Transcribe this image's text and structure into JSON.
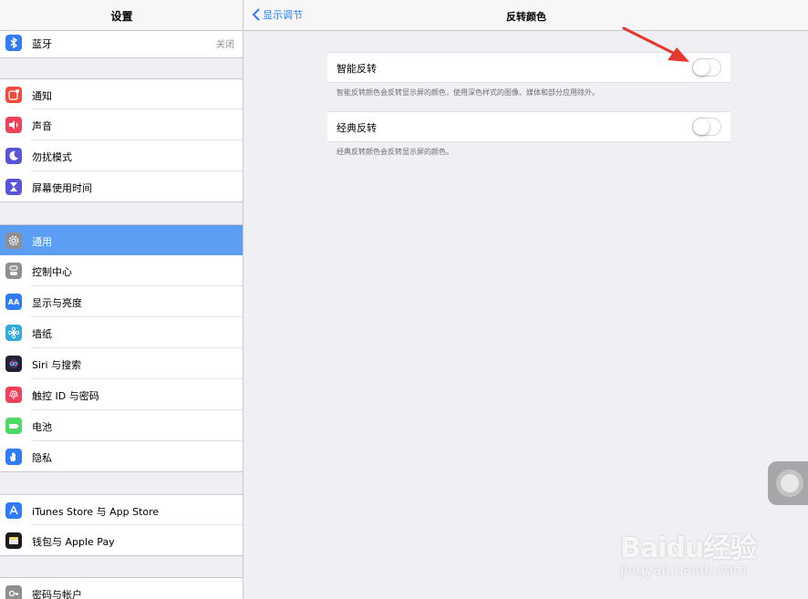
{
  "sidebar": {
    "title": "设置",
    "items": [
      {
        "label": "蓝牙",
        "value": "关闭",
        "icon": "bluetooth-icon",
        "color": "#2f7cf6"
      },
      {
        "label": "通知",
        "icon": "notifications-icon",
        "color": "#f24a3c"
      },
      {
        "label": "声音",
        "icon": "sound-icon",
        "color": "#f0415b"
      },
      {
        "label": "勿扰模式",
        "icon": "moon-icon",
        "color": "#5a55d6"
      },
      {
        "label": "屏幕使用时间",
        "icon": "hourglass-icon",
        "color": "#5a55d6"
      },
      {
        "label": "通用",
        "icon": "gear-icon",
        "color": "#8e8e93"
      },
      {
        "label": "控制中心",
        "icon": "toggles-icon",
        "color": "#8e8e93"
      },
      {
        "label": "显示与亮度",
        "icon": "display-icon",
        "color": "#2f7cf6"
      },
      {
        "label": "墙纸",
        "icon": "wallpaper-icon",
        "color": "#35aadc"
      },
      {
        "label": "Siri 与搜索",
        "icon": "siri-icon",
        "color": "#222233"
      },
      {
        "label": "触控 ID 与密码",
        "icon": "fingerprint-icon",
        "color": "#f0415b"
      },
      {
        "label": "电池",
        "icon": "battery-icon",
        "color": "#4cd964"
      },
      {
        "label": "隐私",
        "icon": "hand-icon",
        "color": "#2f7cf6"
      },
      {
        "label": "iTunes Store 与 App Store",
        "icon": "app-store-icon",
        "color": "#2f7cf6"
      },
      {
        "label": "钱包与 Apple Pay",
        "icon": "wallet-icon",
        "color": "#1c1c1e"
      },
      {
        "label": "密码与帐户",
        "icon": "key-icon",
        "color": "#8e8e93"
      }
    ]
  },
  "nav": {
    "back_label": "显示调节",
    "title": "反转颜色"
  },
  "settings": {
    "smart_invert": {
      "label": "智能反转",
      "footer": "智能反转颜色会反转显示屏的颜色，使用深色样式的图像、媒体和部分应用除外。"
    },
    "classic_invert": {
      "label": "经典反转",
      "footer": "经典反转颜色会反转显示屏的颜色。"
    }
  },
  "watermark": {
    "brand": "Baidu经验",
    "url": "jingyan.baidu.com"
  },
  "colors": {
    "accent": "#2f7cf6",
    "selected": "#5d9ef5",
    "annotation_arrow": "#e8372e"
  }
}
